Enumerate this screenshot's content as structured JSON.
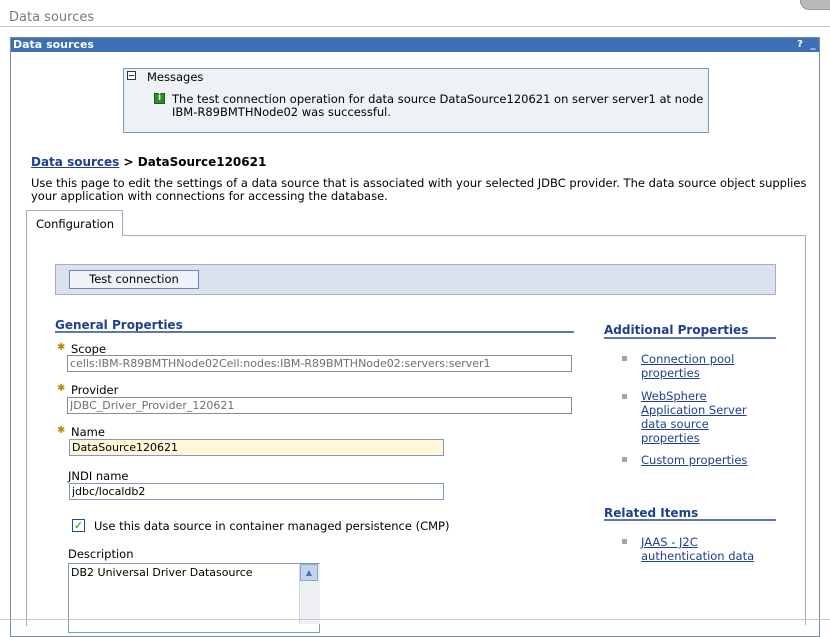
{
  "page": {
    "title": "Data sources"
  },
  "portlet": {
    "title": "Data sources",
    "help_glyph": "?",
    "minimize_glyph": "_"
  },
  "messages": {
    "heading": "Messages",
    "info_glyph": "i",
    "text": "The test connection operation for data source DataSource120621 on server server1 at node IBM-R89BMTHNode02 was successful."
  },
  "breadcrumb": {
    "link": "Data sources",
    "separator": " > ",
    "current": "DataSource120621"
  },
  "description": "Use this page to edit the settings of a data source that is associated with your selected JDBC provider. The data source object supplies your application with connections for accessing the database.",
  "tabs": [
    {
      "label": "Configuration"
    }
  ],
  "buttons": {
    "test_connection": "Test connection"
  },
  "general": {
    "heading": "General Properties",
    "required_glyph": "✱",
    "scope": {
      "label": "Scope",
      "value": "cells:IBM-R89BMTHNode02Cell:nodes:IBM-R89BMTHNode02:servers:server1"
    },
    "provider": {
      "label": "Provider",
      "value": "JDBC_Driver_Provider_120621"
    },
    "name": {
      "label": "Name",
      "value": "DataSource120621"
    },
    "jndi": {
      "label": "JNDI name",
      "value": "jdbc/localdb2"
    },
    "cmp": {
      "label": "Use this data source in container managed persistence (CMP)",
      "checked": true,
      "check_glyph": "✓"
    },
    "description": {
      "label": "Description",
      "value": "DB2 Universal Driver Datasource"
    }
  },
  "additional": {
    "heading": "Additional Properties",
    "links": [
      [
        "Connection pool",
        "properties"
      ],
      [
        "WebSphere",
        "Application Server",
        "data source",
        "properties"
      ],
      [
        "Custom properties"
      ]
    ]
  },
  "related": {
    "heading": "Related Items",
    "links": [
      [
        "JAAS - J2C",
        "authentication data"
      ]
    ]
  },
  "scroll_up_glyph": "▲",
  "colors": {
    "title_bar": "#3d6fb4",
    "link": "#1f3f8f",
    "required_field_bg": "#fff7d7"
  }
}
